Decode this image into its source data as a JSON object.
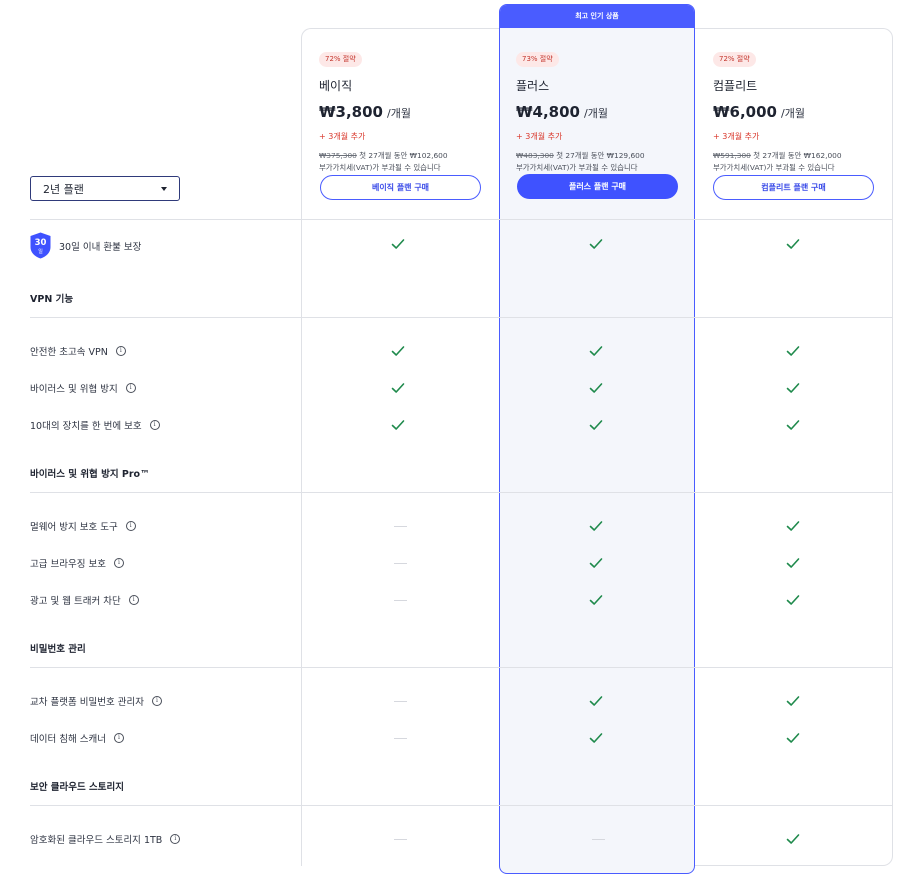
{
  "plan_selector": {
    "value": "2년 플랜"
  },
  "popular_banner": "최고 인기 상품",
  "plans": [
    {
      "discount": "72% 절약",
      "name": "베이직",
      "price": "₩3,800",
      "unit": "/개월",
      "extra": "+ 3개월 추가",
      "original_price": "₩375,300",
      "first_period": "첫 27개월 동안 ₩102,600",
      "vat_note": "부가가치세(VAT)가 부과될 수 있습니다",
      "button": "베이직 플랜 구매"
    },
    {
      "discount": "73% 절약",
      "name": "플러스",
      "price": "₩4,800",
      "unit": "/개월",
      "extra": "+ 3개월 추가",
      "original_price": "₩483,300",
      "first_period": "첫 27개월 동안 ₩129,600",
      "vat_note": "부가가치세(VAT)가 부과될 수 있습니다",
      "button": "플러스 플랜 구매"
    },
    {
      "discount": "72% 절약",
      "name": "컴플리트",
      "price": "₩6,000",
      "unit": "/개월",
      "extra": "+ 3개월 추가",
      "original_price": "₩591,300",
      "first_period": "첫 27개월 동안 ₩162,000",
      "vat_note": "부가가치세(VAT)가 부과될 수 있습니다",
      "button": "컴플리트 플랜 구매"
    }
  ],
  "guarantee": {
    "badge_number": "30",
    "badge_unit": "일",
    "label": "30일 이내 환불 보장"
  },
  "sections": [
    {
      "title": "VPN 기능",
      "features": [
        {
          "label": "안전한 초고속 VPN",
          "values": [
            true,
            true,
            true
          ]
        },
        {
          "label": "바이러스 및 위협 방지",
          "values": [
            true,
            true,
            true
          ]
        },
        {
          "label": "10대의 장치를 한 번에 보호",
          "values": [
            true,
            true,
            true
          ]
        }
      ]
    },
    {
      "title": "바이러스 및 위협 방지 Pro™",
      "features": [
        {
          "label": "멀웨어 방지 보호 도구",
          "values": [
            false,
            true,
            true
          ]
        },
        {
          "label": "고급 브라우징 보호",
          "values": [
            false,
            true,
            true
          ]
        },
        {
          "label": "광고 및 웹 트래커 차단",
          "values": [
            false,
            true,
            true
          ]
        }
      ]
    },
    {
      "title": "비밀번호 관리",
      "features": [
        {
          "label": "교차 플랫폼 비밀번호 관리자",
          "values": [
            false,
            true,
            true
          ]
        },
        {
          "label": "데이터 침해 스캐너",
          "values": [
            false,
            true,
            true
          ]
        }
      ]
    },
    {
      "title": "보안 클라우드 스토리지",
      "features": [
        {
          "label": "암호화된 클라우드 스토리지 1TB",
          "values": [
            false,
            false,
            true
          ]
        }
      ]
    }
  ],
  "colors": {
    "accent": "#4a5cff",
    "check": "#1f8a4c",
    "discount_text": "#c4352c"
  }
}
